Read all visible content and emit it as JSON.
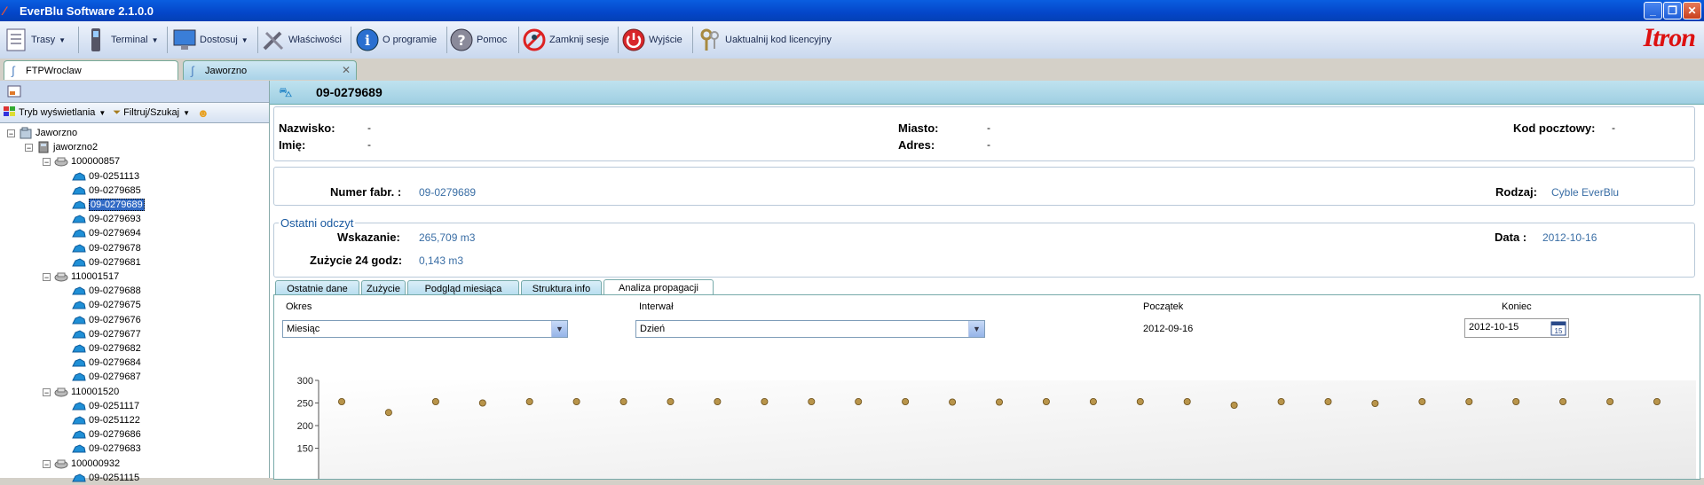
{
  "window": {
    "title": "EverBlu Software 2.1.0.0",
    "min_glyph": "_",
    "max_glyph": "❐",
    "close_glyph": "✕"
  },
  "toolbar": {
    "trasy": "Trasy",
    "terminal": "Terminal",
    "dostosuj": "Dostosuj",
    "wlasciwosci": "Właściwości",
    "o_programie": "O programie",
    "pomoc": "Pomoc",
    "zamknij_sesje": "Zamknij sesje",
    "wyjscie": "Wyjście",
    "uaktualnij": "Uaktualnij kod licencyjny",
    "brand": "Itron"
  },
  "doc_tabs": [
    {
      "label": "FTPWroclaw"
    },
    {
      "label": "Jaworzno"
    }
  ],
  "left_panel": {
    "display_mode": "Tryb wyświetlania",
    "filter_search": "Filtruj/Szukaj"
  },
  "tree": {
    "root": "Jaworzno",
    "site": "jaworzno2",
    "groups": [
      {
        "label": "100000857",
        "items": [
          "09-0251113",
          "09-0279685",
          "09-0279689",
          "09-0279693",
          "09-0279694",
          "09-0279678",
          "09-0279681"
        ]
      },
      {
        "label": "110001517",
        "items": [
          "09-0279688",
          "09-0279675",
          "09-0279676",
          "09-0279677",
          "09-0279682",
          "09-0279684",
          "09-0279687"
        ]
      },
      {
        "label": "110001520",
        "items": [
          "09-0251117",
          "09-0251122",
          "09-0279686",
          "09-0279683"
        ]
      },
      {
        "label": "100000932",
        "items": [
          "09-0251115"
        ]
      }
    ],
    "selected": "09-0279689"
  },
  "detail": {
    "meter_id": "09-0279689",
    "nazwisko_label": "Nazwisko:",
    "nazwisko": "-",
    "imie_label": "Imię:",
    "imie": "-",
    "miasto_label": "Miasto:",
    "miasto": "-",
    "adres_label": "Adres:",
    "adres": "-",
    "kod_label": "Kod pocztowy:",
    "kod": "-",
    "numer_label": "Numer fabr. :",
    "numer": "09-0279689",
    "rodzaj_label": "Rodzaj:",
    "rodzaj": "Cyble EverBlu",
    "section_title": "Ostatni odczyt",
    "wskazanie_label": "Wskazanie:",
    "wskazanie": "265,709 m3",
    "zuzycie_label": "Zużycie 24 godz:",
    "zuzycie": "0,143 m3",
    "data_label": "Data :",
    "data": "2012-10-16"
  },
  "inner_tabs": [
    {
      "label": "Ostatnie dane"
    },
    {
      "label": "Zużycie"
    },
    {
      "label": "Podgląd miesiąca"
    },
    {
      "label": "Struktura info"
    },
    {
      "label": "Analiza propagacji"
    }
  ],
  "propagation": {
    "okres_label": "Okres",
    "okres_value": "Miesiąc",
    "interwal_label": "Interwał",
    "interwal_value": "Dzień",
    "poczatek_label": "Początek",
    "poczatek_value": "2012-09-16",
    "koniec_label": "Koniec",
    "koniec_value": "2012-10-15",
    "calendar_day": "15"
  },
  "chart_data": {
    "type": "scatter",
    "y_ticks": [
      "300",
      "250",
      "200",
      "150"
    ],
    "y_visible_range": [
      150,
      300
    ],
    "values": [
      253,
      229,
      253,
      250,
      253,
      253,
      253,
      253,
      253,
      253,
      253,
      253,
      253,
      252,
      252,
      253,
      253,
      253,
      253,
      245,
      253,
      253,
      249,
      253,
      253,
      253,
      253,
      253,
      253
    ],
    "point_color": "#b8944a"
  }
}
